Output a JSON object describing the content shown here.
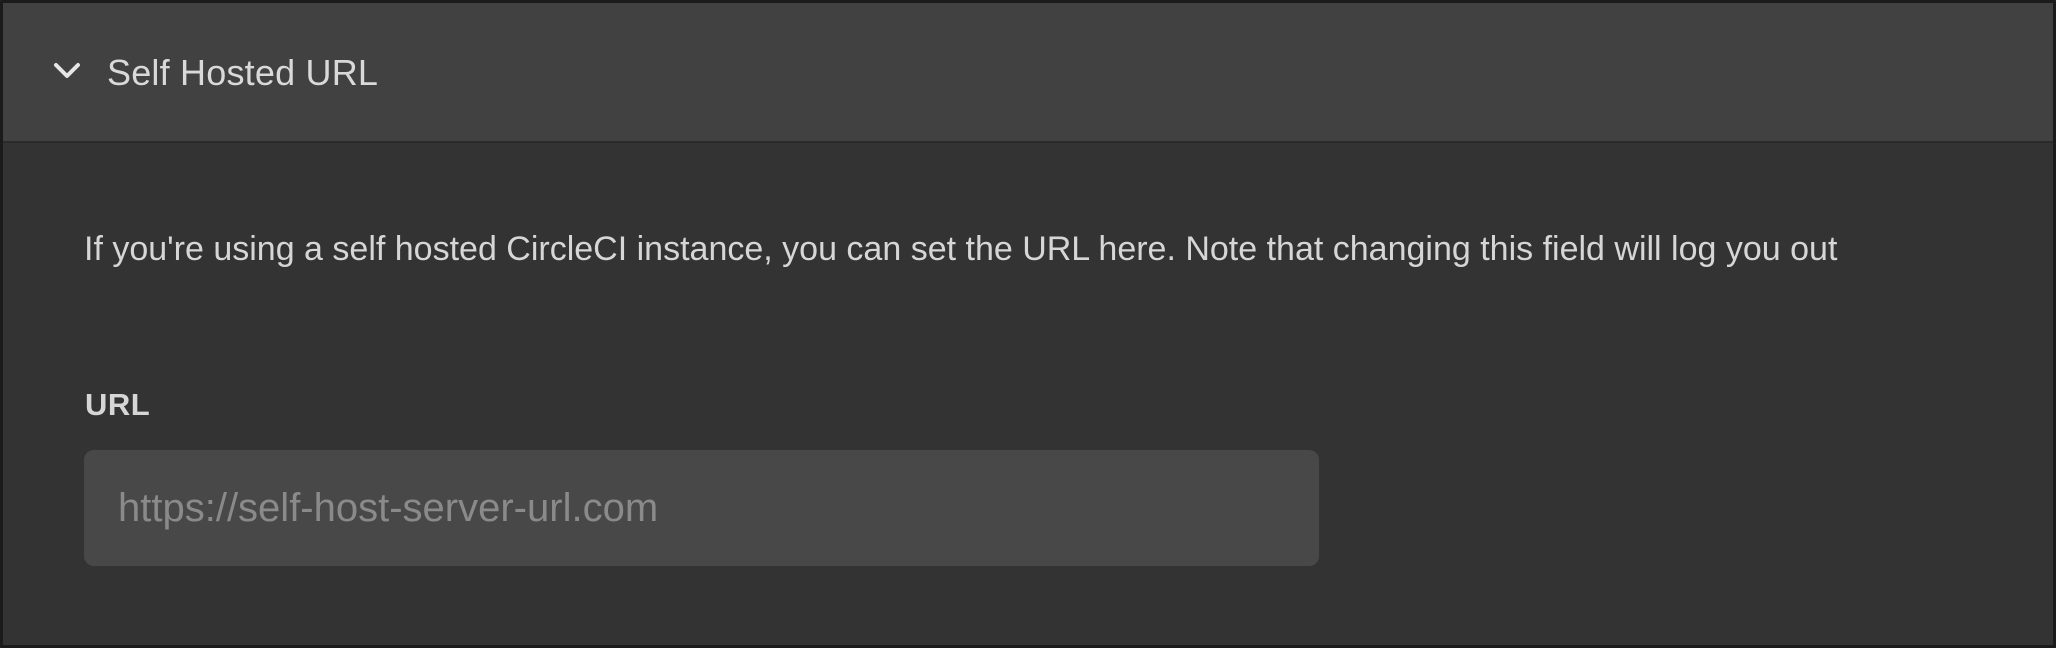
{
  "section": {
    "title": "Self Hosted URL",
    "expanded": true,
    "toggle_icon": "chevron-down-icon"
  },
  "content": {
    "description": "If you're using a self hosted CircleCI instance, you can set the URL here. Note that changing this field will log you out",
    "url_field": {
      "label": "URL",
      "value": "",
      "placeholder": "https://self-host-server-url.com"
    }
  },
  "colors": {
    "panel_background": "#333333",
    "header_background": "#414141",
    "input_background": "#484848",
    "text": "#d6d6d6",
    "placeholder_text": "#8a8a8a"
  }
}
